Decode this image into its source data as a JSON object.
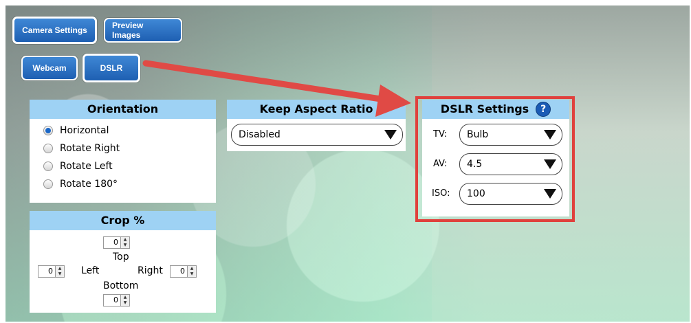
{
  "top_tabs": {
    "camera_settings": "Camera Settings",
    "preview_images": "Preview Images"
  },
  "sub_tabs": {
    "webcam": "Webcam",
    "dslr": "DSLR"
  },
  "orientation": {
    "title": "Orientation",
    "options": [
      "Horizontal",
      "Rotate Right",
      "Rotate Left",
      "Rotate 180°"
    ],
    "selected": "Horizontal"
  },
  "aspect": {
    "title": "Keep Aspect Ratio",
    "value": "Disabled"
  },
  "dslr": {
    "title": "DSLR Settings",
    "help": "?",
    "tv_label": "TV:",
    "tv_value": "Bulb",
    "av_label": "AV:",
    "av_value": "4.5",
    "iso_label": "ISO:",
    "iso_value": "100"
  },
  "crop": {
    "title": "Crop %",
    "top_label": "Top",
    "top_value": "0",
    "left_label": "Left",
    "left_value": "0",
    "right_label": "Right",
    "right_value": "0",
    "bottom_label": "Bottom",
    "bottom_value": "0"
  },
  "colors": {
    "highlight": "#e0403c",
    "arrow": "#e04a45",
    "panel_header": "#9ed2f4",
    "button": "#2e73c4"
  }
}
